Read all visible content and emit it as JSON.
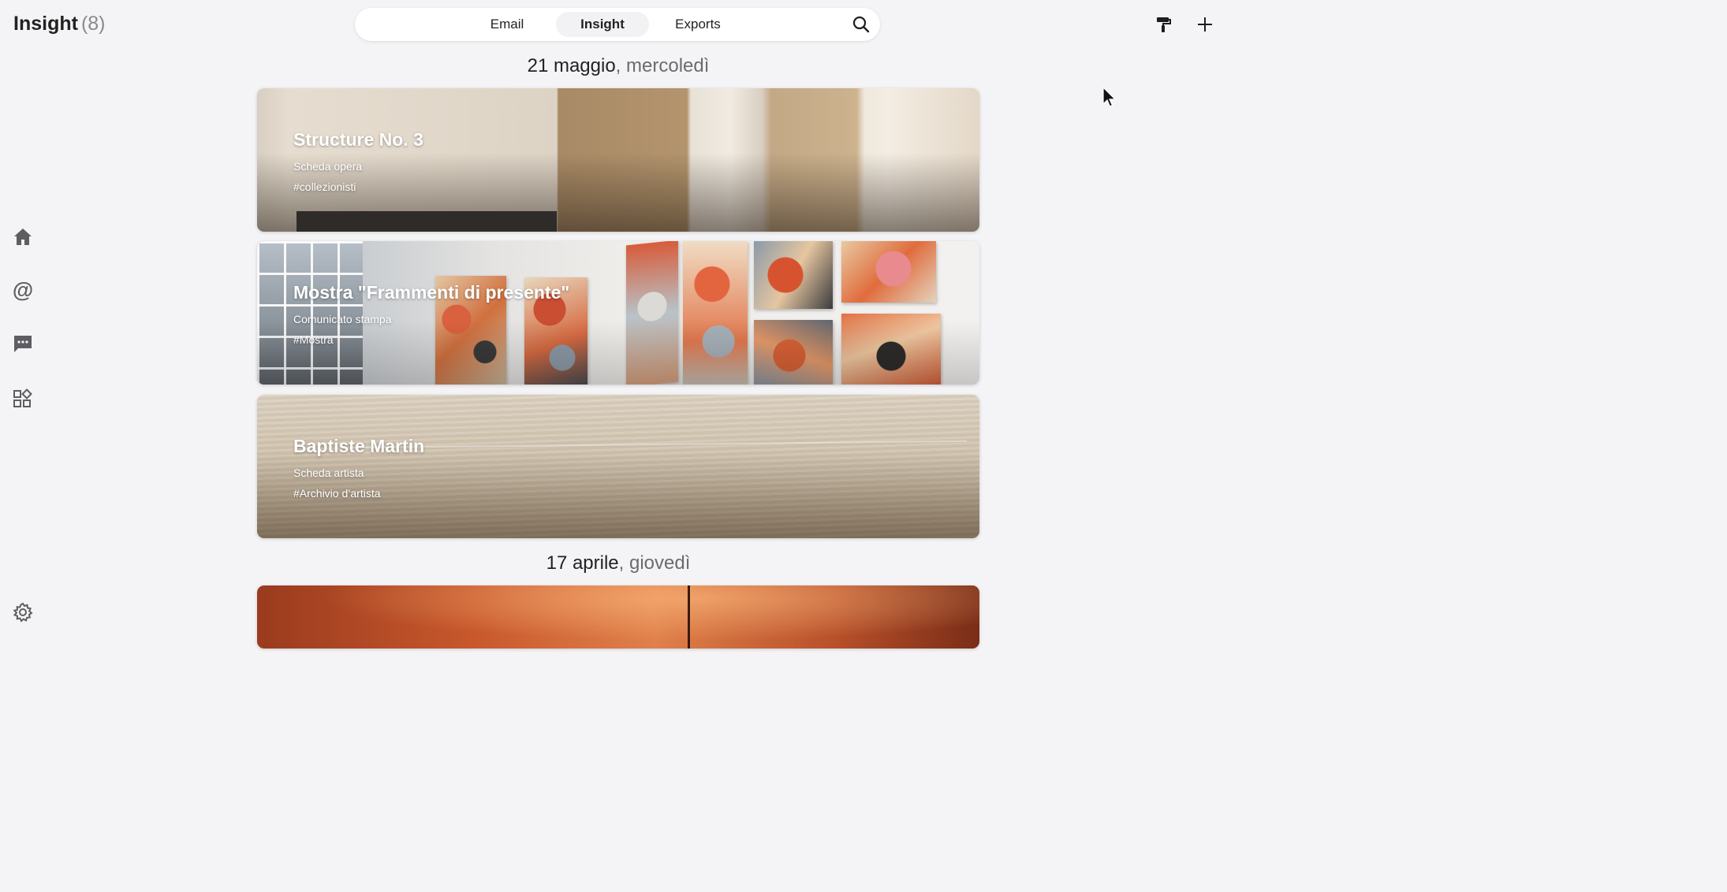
{
  "header": {
    "title": "Insight",
    "count": "(8)"
  },
  "nav": {
    "tabs": [
      {
        "label": "Email",
        "active": false
      },
      {
        "label": "Insight",
        "active": true
      },
      {
        "label": "Exports",
        "active": false
      }
    ],
    "search_icon": "search-icon"
  },
  "actions": {
    "paint_icon": "paint-roller-icon",
    "add_icon": "plus-icon"
  },
  "sidebar": {
    "items": [
      {
        "name": "home",
        "icon": "home-icon"
      },
      {
        "name": "mentions",
        "icon": "at-icon",
        "glyph": "@"
      },
      {
        "name": "messages",
        "icon": "chat-icon"
      },
      {
        "name": "apps",
        "icon": "apps-icon"
      }
    ],
    "settings_icon": "gear-icon"
  },
  "feed": {
    "groups": [
      {
        "date": "21 maggio",
        "weekday": ", mercoledì",
        "cards": [
          {
            "title": "Structure No. 3",
            "subtitle": "Scheda opera",
            "tag": "#collezionisti"
          },
          {
            "title": "Mostra \"Frammenti di presente\"",
            "subtitle": "Comunicato stampa",
            "tag": "#Mostra"
          },
          {
            "title": "Baptiste Martin",
            "subtitle": "Scheda artista",
            "tag": "#Archivio d’artista"
          }
        ]
      },
      {
        "date": "17 aprile",
        "weekday": ", giovedì",
        "cards": []
      }
    ]
  },
  "colors": {
    "background": "#f4f4f6",
    "nav_bg": "#ffffff",
    "active_tab": "#f2f2f4",
    "icon_gray": "#5d5d62"
  }
}
